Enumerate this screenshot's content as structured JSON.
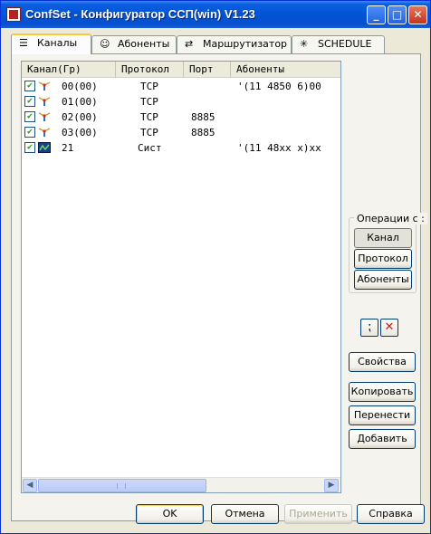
{
  "window": {
    "title": "ConfSet - Конфигуратор  ССП(win)  V1.23"
  },
  "titlebar_buttons": {
    "minimize": "_",
    "maximize": "□",
    "close": "✕"
  },
  "tabs": [
    {
      "label": "Каналы",
      "icon": "list-icon",
      "glyph": "☰"
    },
    {
      "label": "Абоненты",
      "icon": "subscriber-icon",
      "glyph": "☺"
    },
    {
      "label": "Маршрутизатор",
      "icon": "router-icon",
      "glyph": "⇄"
    },
    {
      "label": "SCHEDULE",
      "icon": "schedule-icon",
      "glyph": "✳"
    }
  ],
  "table": {
    "columns": [
      "Канал(Гр)",
      "Протокол",
      "Порт",
      "Абоненты"
    ],
    "rows": [
      {
        "checked": true,
        "icon": "antenna-icon",
        "channel": "00(00)",
        "protocol": "TCP",
        "port": "",
        "subscribers": "'(11 4850 6)00"
      },
      {
        "checked": true,
        "icon": "antenna-icon",
        "channel": "01(00)",
        "protocol": "TCP",
        "port": "",
        "subscribers": ""
      },
      {
        "checked": true,
        "icon": "antenna-icon",
        "channel": "02(00)",
        "protocol": "TCP",
        "port": "8885",
        "subscribers": ""
      },
      {
        "checked": true,
        "icon": "antenna-icon",
        "channel": "03(00)",
        "protocol": "TCP",
        "port": "8885",
        "subscribers": ""
      },
      {
        "checked": true,
        "icon": "system-icon",
        "channel": "21",
        "protocol": "Сист",
        "port": "",
        "subscribers": "'(11 48xx x)xx"
      }
    ]
  },
  "operations": {
    "title": "Операции с :",
    "channel": "Канал",
    "protocol": "Протокол",
    "subscribers": "Абоненты"
  },
  "icons": {
    "check": "✔",
    "separator": "⁏",
    "delete": "✕",
    "scroll_left": "◀",
    "scroll_right": "▶"
  },
  "actions": {
    "properties": "Свойства",
    "copy": "Копировать",
    "move": "Перенести",
    "add": "Добавить"
  },
  "footer": {
    "ok": "OK",
    "cancel": "Отмена",
    "apply": "Применить",
    "help": "Справка"
  },
  "colors": {
    "titlebar": "#0353d6",
    "tab_accent": "#ffc83c",
    "delete": "#d41717"
  }
}
